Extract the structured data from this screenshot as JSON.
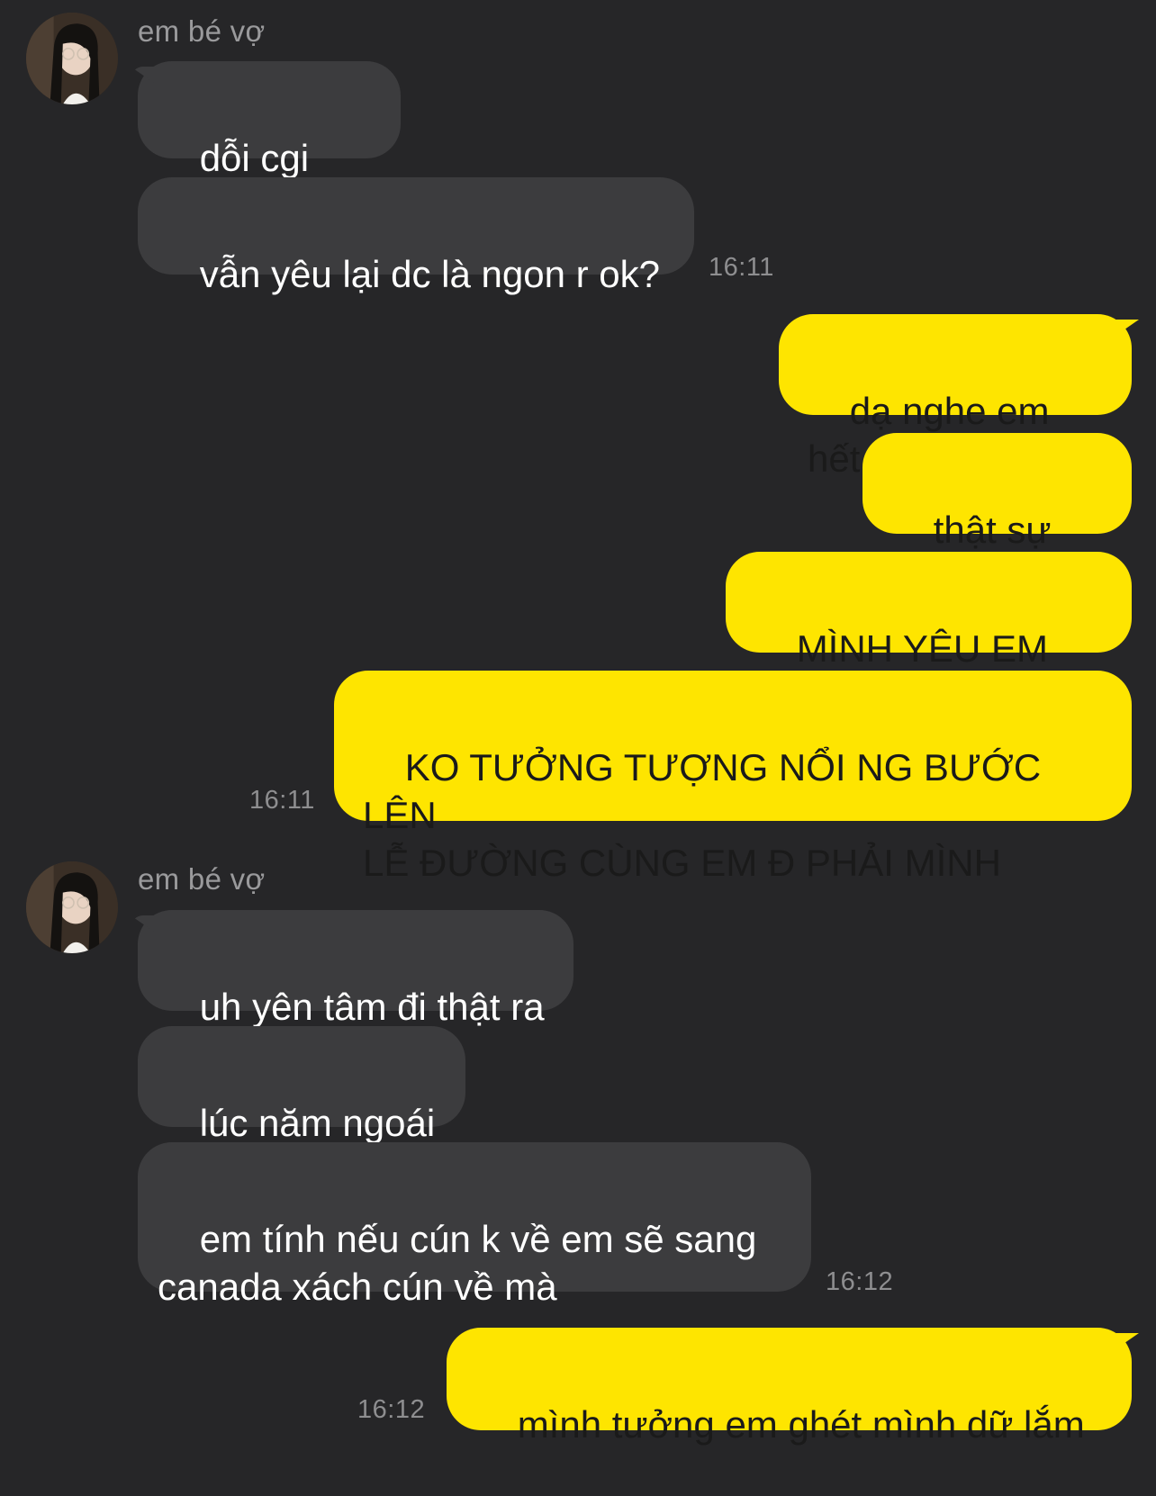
{
  "contact": {
    "name": "em bé vợ",
    "avatar_icon": "profile-photo-girl-with-glasses"
  },
  "colors": {
    "background": "#262628",
    "incoming_bubble": "#3c3c3e",
    "outgoing_bubble": "#fee500",
    "timestamp": "#8e8e90"
  },
  "groups": [
    {
      "sender": "em bé vợ",
      "messages": [
        "dỗi cgi =))))",
        "vẫn yêu lại dc là ngon r ok?"
      ],
      "time": "16:11"
    },
    {
      "sender": "me",
      "messages": [
        "dạ nghe em hết",
        "thật sự đấy",
        "MÌNH YÊU EM VL Í",
        "KO TƯỞNG TƯỢNG NỔI NG BƯỚC LÊN\nLỄ ĐƯỜNG CÙNG EM Đ PHẢI MÌNH"
      ],
      "time": "16:11"
    },
    {
      "sender": "em bé vợ",
      "messages": [
        "uh yên tâm đi thật ra",
        "lúc năm ngoái í",
        "em tính nếu cún k về em sẽ sang\ncanada xách cún về mà"
      ],
      "time": "16:12"
    },
    {
      "sender": "me",
      "messages": [
        "mình tưởng em ghét mình dữ lắm"
      ],
      "time": "16:12"
    }
  ]
}
